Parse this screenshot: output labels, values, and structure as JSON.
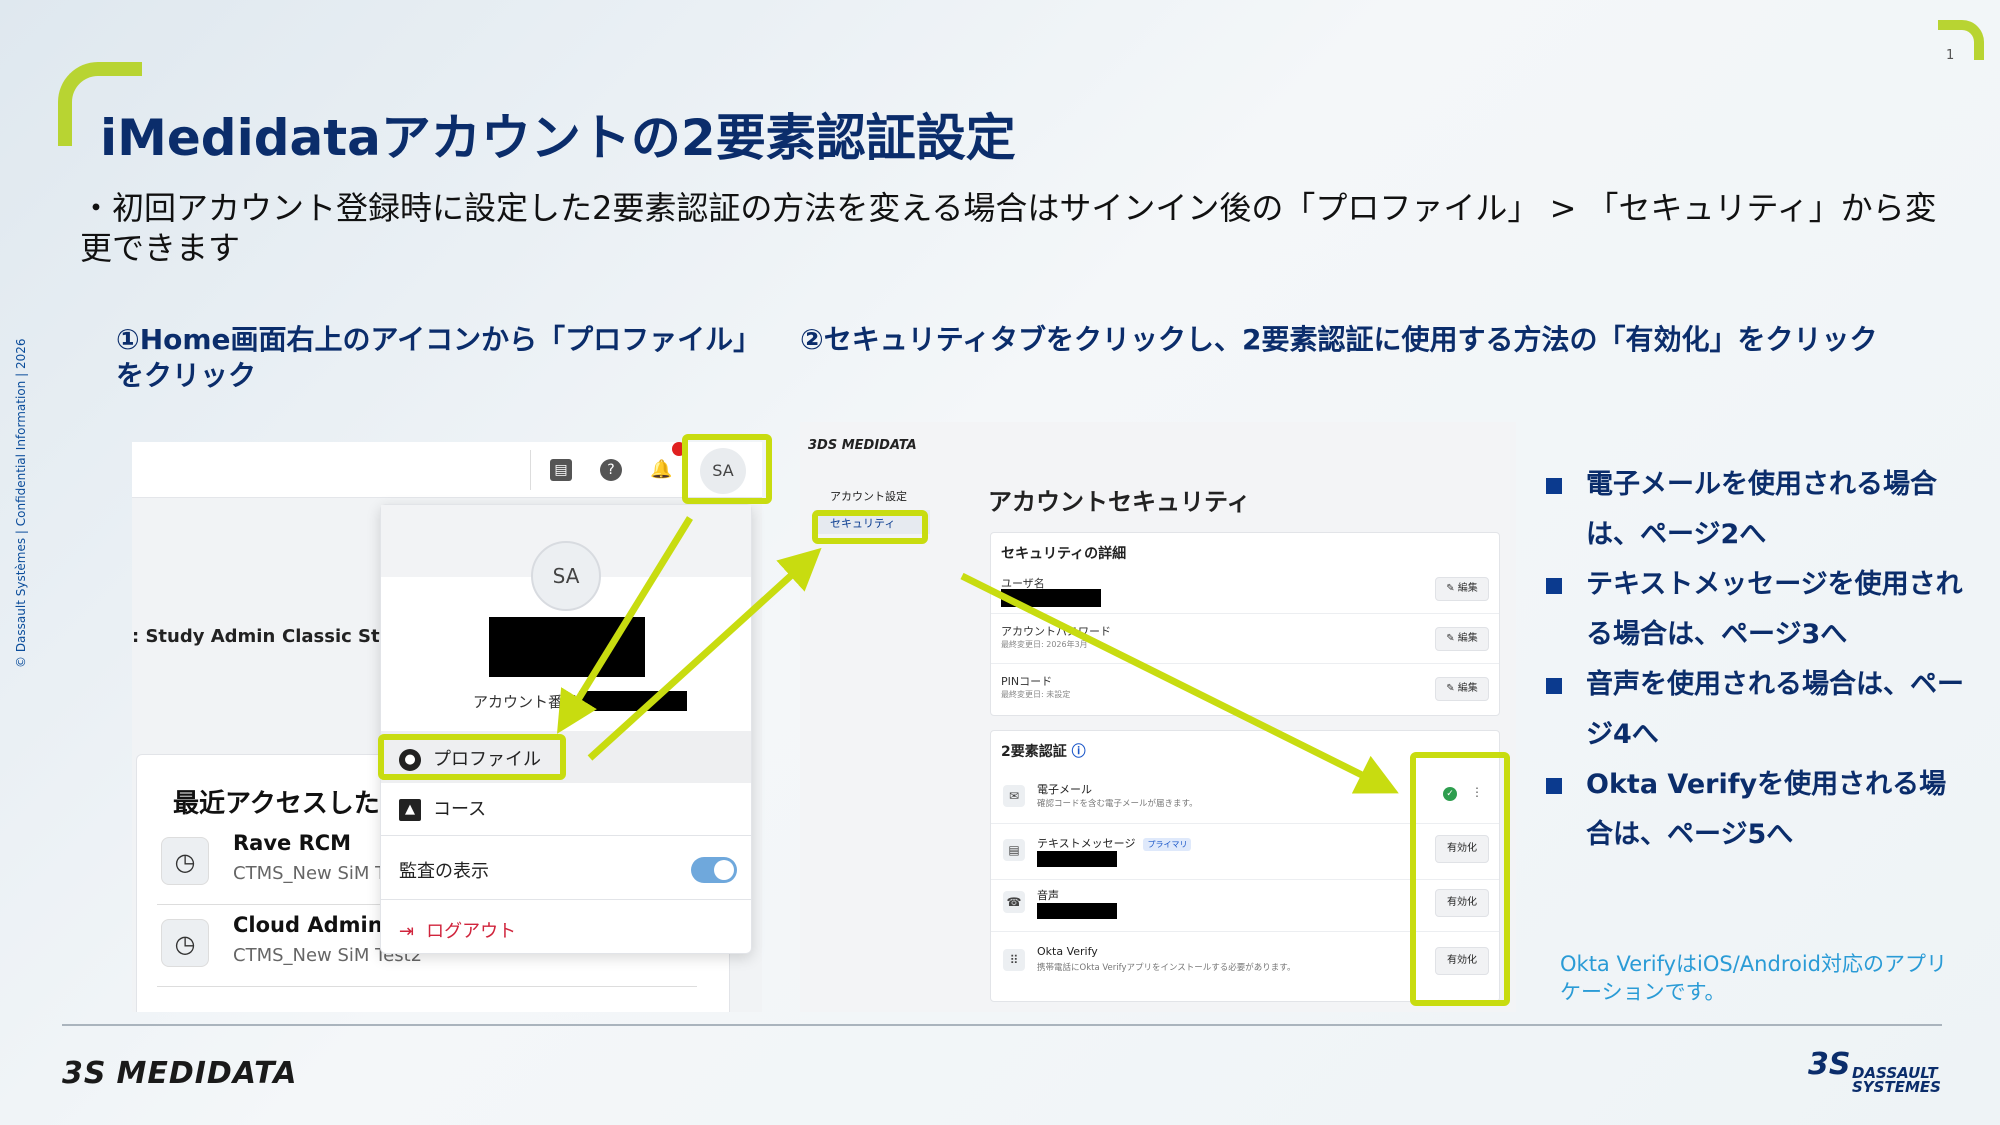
{
  "page_number": "1",
  "title": "iMedidataアカウントの2要素認証設定",
  "intro": "・初回アカウント登録時に設定した2要素認証の方法を変える場合はサインイン後の「プロファイル」 > 「セキュリティ」から変更できます",
  "step1": "①Home画面右上のアイコンから「プロファイル」をクリック",
  "step2": "②セキュリティタブをクリックし、2要素認証に使用する方法の「有効化」をクリック",
  "copyright": "© Dassault Systèmes | Confidential Information | 2026",
  "left_shot": {
    "avatar_initials": "SA",
    "study_admin": ": Study Admin",
    "classic_study": "Classic Stud",
    "recent_title": "最近アクセスしたＩ",
    "recent_items": [
      {
        "name": "Rave RCM",
        "sub": "CTMS_New SiM Te"
      },
      {
        "name": "Cloud Admin",
        "sub": "CTMS_New SiM Test2"
      }
    ],
    "dropdown": {
      "avatar_initials": "SA",
      "account_number_label": "アカウント番号",
      "profile": "プロファイル",
      "course": "コース",
      "audit_view": "監査の表示",
      "logout": "ログアウト"
    }
  },
  "right_shot": {
    "logo": "3DS MEDIDATA",
    "nav_account_settings": "アカウント設定",
    "nav_security": "セキュリティ",
    "page_title": "アカウントセキュリティ",
    "details_card": {
      "title": "セキュリティの詳細",
      "username": "ユーザ名",
      "password": "アカウントパスワード",
      "password_sub": "最終変更日: 2026年3月",
      "pin": "PINコード",
      "pin_sub": "最終変更日: 未設定",
      "edit": "編集"
    },
    "mfa_card": {
      "title": "2要素認証",
      "email": "電子メール",
      "email_sub": "確認コードを含む電子メールが届きます。",
      "text": "テキストメッセージ",
      "primary": "プライマリ",
      "voice": "音声",
      "okta": "Okta Verify",
      "okta_sub": "携帯電話にOkta Verifyアプリをインストールする必要があります。",
      "enable": "有効化"
    }
  },
  "bullets": [
    "電子メールを使用される場合は、ページ2へ",
    "テキストメッセージを使用される場合は、ページ3へ",
    "音声を使用される場合は、ページ4へ",
    "Okta Verifyを使用される場合は、ページ5へ"
  ],
  "okta_note": "Okta VerifyはiOS/Android対応のアプリケーションです。",
  "footer_logo": "MEDIDATA",
  "footer_ds": "DASSAULT SYSTEMES",
  "colors": {
    "accent": "#c8dc10",
    "title": "#0b2d6b",
    "note": "#2a9bd6"
  }
}
